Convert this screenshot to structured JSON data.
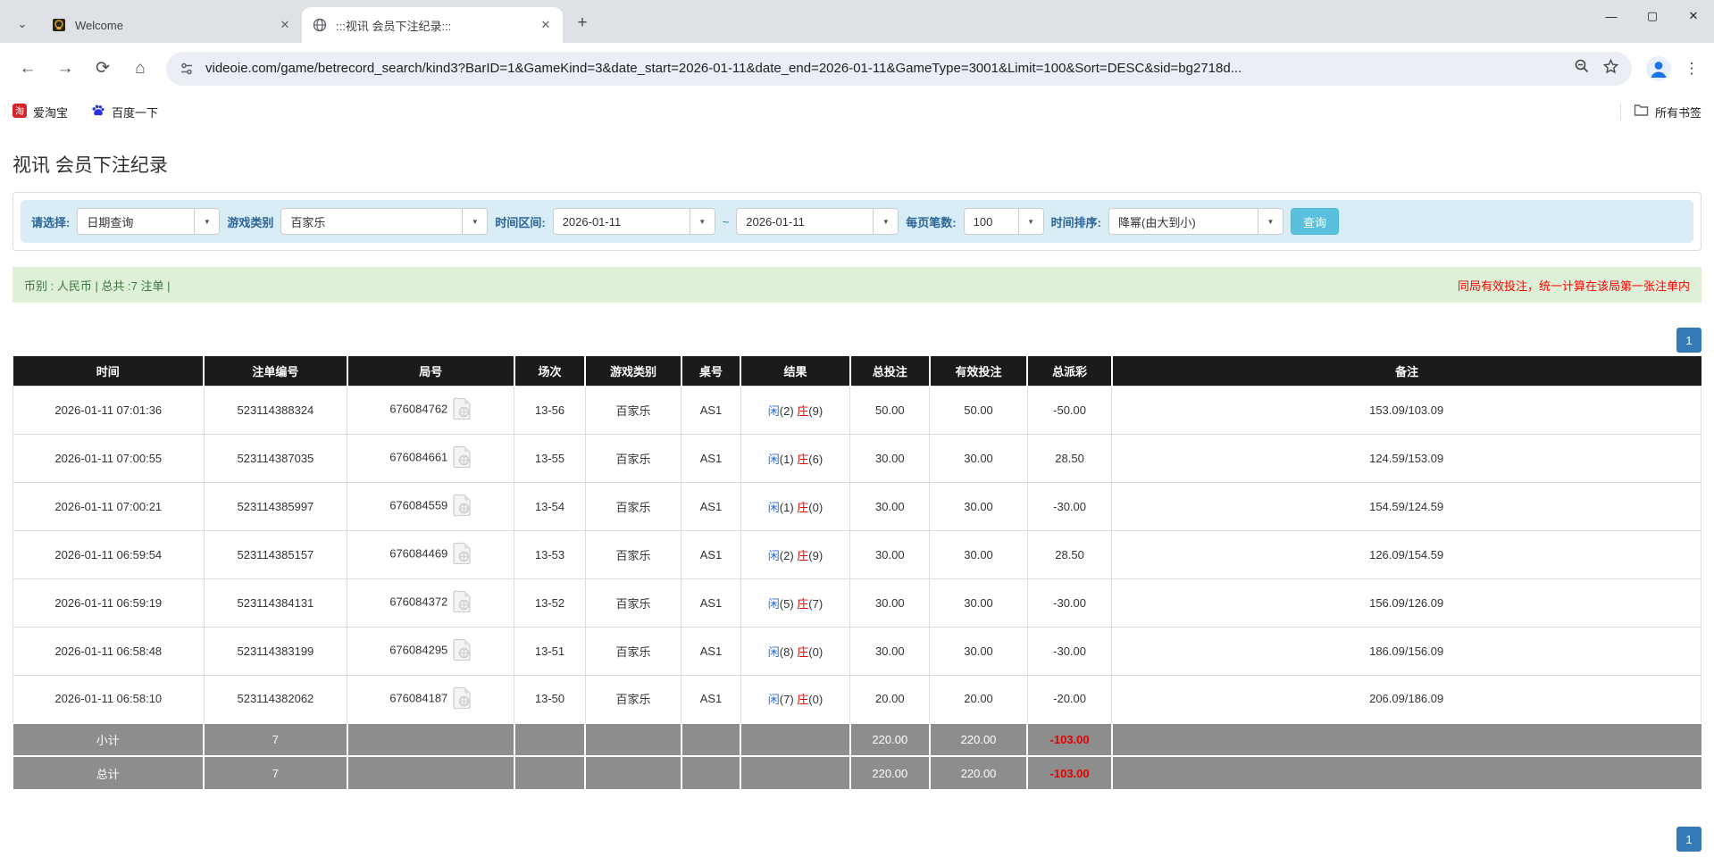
{
  "browser": {
    "tab_search_icon": "⌄",
    "tabs": [
      {
        "title": "Welcome"
      },
      {
        "title": ":::视讯 会员下注纪录:::"
      }
    ],
    "close_glyph": "✕",
    "new_tab_glyph": "+",
    "window": {
      "minimize": "—",
      "maximize": "▢",
      "close": "✕"
    },
    "nav": {
      "back": "←",
      "forward": "→",
      "reload": "⟳",
      "home": "⌂"
    },
    "url": "videoie.com/game/betrecord_search/kind3?BarID=1&GameKind=3&date_start=2026-01-11&date_end=2026-01-11&GameType=3001&Limit=100&Sort=DESC&sid=bg2718d...",
    "kebab_glyph": "⋮",
    "bookmarks": [
      {
        "label": "爱淘宝",
        "icon": "taobao"
      },
      {
        "label": "百度一下",
        "icon": "baidu"
      }
    ],
    "all_bookmarks_label": "所有书签"
  },
  "page": {
    "title": "视讯 会员下注纪录",
    "filters": {
      "select_label": "请选择:",
      "select_value": "日期查询",
      "game_kind_label": "游戏类别",
      "game_kind_value": "百家乐",
      "date_range_label": "时间区间:",
      "date_start": "2026-01-11",
      "tilde": "~",
      "date_end": "2026-01-11",
      "per_page_label": "每页笔数:",
      "per_page_value": "100",
      "sort_label": "时间排序:",
      "sort_value": "降幂(由大到小)",
      "query_button": "查询",
      "caret_glyph": "▼"
    },
    "summary": {
      "left": "币别 : 人民币 | 总共 :7 注单 |",
      "right_note": "同局有效投注，统一计算在该局第一张注单内"
    },
    "pagination": {
      "page": "1"
    },
    "table": {
      "headers": [
        "时间",
        "注单编号",
        "局号",
        "场次",
        "游戏类别",
        "桌号",
        "结果",
        "总投注",
        "有效投注",
        "总派彩",
        "备注"
      ],
      "col_widths": [
        "11.3%",
        "8.5%",
        "9.9%",
        "4.2%",
        "5.7%",
        "3.5%",
        "6.5%",
        "4.7%",
        "5.8%",
        "5.0%",
        "34.9%"
      ],
      "rows": [
        {
          "time": "2026-01-11 07:01:36",
          "bet_id": "523114388324",
          "round_id": "676084762",
          "session": "13-56",
          "game": "百家乐",
          "table_no": "AS1",
          "player_label": "闲",
          "player_num": "(2)",
          "banker_label": "庄",
          "banker_num": "(9)",
          "total_bet": "50.00",
          "valid_bet": "50.00",
          "payout": "-50.00",
          "note": "153.09/103.09"
        },
        {
          "time": "2026-01-11 07:00:55",
          "bet_id": "523114387035",
          "round_id": "676084661",
          "session": "13-55",
          "game": "百家乐",
          "table_no": "AS1",
          "player_label": "闲",
          "player_num": "(1)",
          "banker_label": "庄",
          "banker_num": "(6)",
          "total_bet": "30.00",
          "valid_bet": "30.00",
          "payout": "28.50",
          "note": "124.59/153.09"
        },
        {
          "time": "2026-01-11 07:00:21",
          "bet_id": "523114385997",
          "round_id": "676084559",
          "session": "13-54",
          "game": "百家乐",
          "table_no": "AS1",
          "player_label": "闲",
          "player_num": "(1)",
          "banker_label": "庄",
          "banker_num": "(0)",
          "total_bet": "30.00",
          "valid_bet": "30.00",
          "payout": "-30.00",
          "note": "154.59/124.59"
        },
        {
          "time": "2026-01-11 06:59:54",
          "bet_id": "523114385157",
          "round_id": "676084469",
          "session": "13-53",
          "game": "百家乐",
          "table_no": "AS1",
          "player_label": "闲",
          "player_num": "(2)",
          "banker_label": "庄",
          "banker_num": "(9)",
          "total_bet": "30.00",
          "valid_bet": "30.00",
          "payout": "28.50",
          "note": "126.09/154.59"
        },
        {
          "time": "2026-01-11 06:59:19",
          "bet_id": "523114384131",
          "round_id": "676084372",
          "session": "13-52",
          "game": "百家乐",
          "table_no": "AS1",
          "player_label": "闲",
          "player_num": "(5)",
          "banker_label": "庄",
          "banker_num": "(7)",
          "total_bet": "30.00",
          "valid_bet": "30.00",
          "payout": "-30.00",
          "note": "156.09/126.09"
        },
        {
          "time": "2026-01-11 06:58:48",
          "bet_id": "523114383199",
          "round_id": "676084295",
          "session": "13-51",
          "game": "百家乐",
          "table_no": "AS1",
          "player_label": "闲",
          "player_num": "(8)",
          "banker_label": "庄",
          "banker_num": "(0)",
          "total_bet": "30.00",
          "valid_bet": "30.00",
          "payout": "-30.00",
          "note": "186.09/156.09"
        },
        {
          "time": "2026-01-11 06:58:10",
          "bet_id": "523114382062",
          "round_id": "676084187",
          "session": "13-50",
          "game": "百家乐",
          "table_no": "AS1",
          "player_label": "闲",
          "player_num": "(7)",
          "banker_label": "庄",
          "banker_num": "(0)",
          "total_bet": "20.00",
          "valid_bet": "20.00",
          "payout": "-20.00",
          "note": "206.09/186.09"
        }
      ],
      "footer_rows": [
        {
          "label": "小计",
          "count": "7",
          "total_bet": "220.00",
          "valid_bet": "220.00",
          "payout": "-103.00"
        },
        {
          "label": "总计",
          "count": "7",
          "total_bet": "220.00",
          "valid_bet": "220.00",
          "payout": "-103.00"
        }
      ]
    }
  },
  "colors": {
    "accent_info": "#d9edf7",
    "accent_success": "#dff0d8",
    "query_button": "#5bc0de",
    "pagination": "#337ab7",
    "header_black": "#1b1b1b",
    "footer_gray": "#8d8d8d",
    "player_blue": "#2a6cd4",
    "banker_red": "#e00000",
    "note_red": "#ff0000"
  }
}
